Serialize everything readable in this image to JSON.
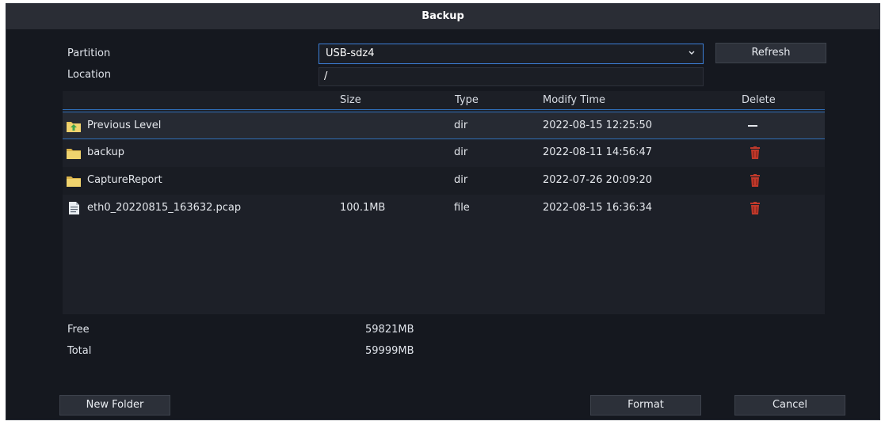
{
  "dialog": {
    "title": "Backup"
  },
  "partition": {
    "label": "Partition",
    "value": "USB-sdz4"
  },
  "location": {
    "label": "Location",
    "value": "/"
  },
  "refresh_label": "Refresh",
  "table": {
    "headers": {
      "size": "Size",
      "type": "Type",
      "modify_time": "Modify Time",
      "delete": "Delete"
    },
    "rows": [
      {
        "name": "Previous Level",
        "size": "",
        "type": "dir",
        "modify_time": "2022-08-15 12:25:50",
        "icon": "folder-up-icon",
        "delete": "none"
      },
      {
        "name": "backup",
        "size": "",
        "type": "dir",
        "modify_time": "2022-08-11 14:56:47",
        "icon": "folder-icon",
        "delete": "trash"
      },
      {
        "name": "CaptureReport",
        "size": "",
        "type": "dir",
        "modify_time": "2022-07-26 20:09:20",
        "icon": "folder-icon",
        "delete": "trash"
      },
      {
        "name": "eth0_20220815_163632.pcap",
        "size": "100.1MB",
        "type": "file",
        "modify_time": "2022-08-15 16:36:34",
        "icon": "file-icon",
        "delete": "trash"
      }
    ]
  },
  "storage": {
    "free_label": "Free",
    "free_value": "59821MB",
    "total_label": "Total",
    "total_value": "59999MB"
  },
  "buttons": {
    "new_folder": "New Folder",
    "format": "Format",
    "cancel": "Cancel"
  },
  "colors": {
    "accent": "#3c7fd8",
    "trash": "#c0392b",
    "folder": "#e8c65a"
  }
}
